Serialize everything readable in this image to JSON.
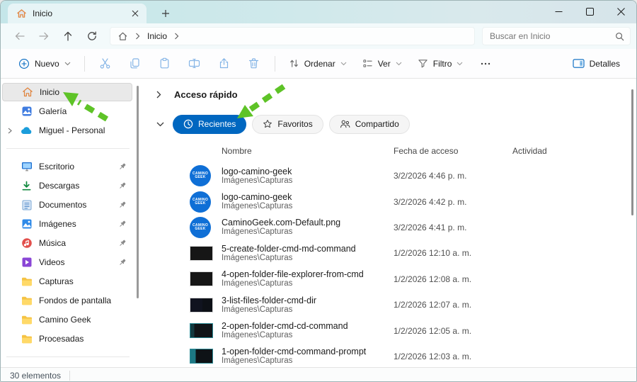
{
  "colors": {
    "accent_blue": "#0067c0",
    "arrow_green": "#5ec327",
    "logo_blue": "#0f6fd6",
    "folder_yellow": "#fdd56b"
  },
  "tab_bar": {
    "tab_label": "Inicio"
  },
  "nav": {
    "breadcrumb_root": "Inicio",
    "search_placeholder": "Buscar en Inicio"
  },
  "toolbar": {
    "new_label": "Nuevo",
    "sort_label": "Ordenar",
    "view_label": "Ver",
    "filter_label": "Filtro",
    "details_label": "Detalles"
  },
  "sidebar": {
    "items": [
      {
        "label": "Inicio",
        "icon": "home",
        "selected": true
      },
      {
        "label": "Galería",
        "icon": "gallery"
      },
      {
        "label": "Miguel - Personal",
        "icon": "onedrive",
        "expandable": true
      },
      {
        "label": "Escritorio",
        "icon": "desktop",
        "pinned": true
      },
      {
        "label": "Descargas",
        "icon": "downloads",
        "pinned": true
      },
      {
        "label": "Documentos",
        "icon": "documents",
        "pinned": true
      },
      {
        "label": "Imágenes",
        "icon": "pictures",
        "pinned": true
      },
      {
        "label": "Música",
        "icon": "music",
        "pinned": true
      },
      {
        "label": "Videos",
        "icon": "videos",
        "pinned": true
      },
      {
        "label": "Capturas",
        "icon": "folder"
      },
      {
        "label": "Fondos de pantalla",
        "icon": "folder"
      },
      {
        "label": "Camino Geek",
        "icon": "folder"
      },
      {
        "label": "Procesadas",
        "icon": "folder"
      }
    ]
  },
  "main": {
    "quick_access_title": "Acceso rápido",
    "tabs": [
      {
        "label": "Recientes",
        "active": true
      },
      {
        "label": "Favoritos",
        "active": false
      },
      {
        "label": "Compartido",
        "active": false
      }
    ],
    "columns": {
      "name": "Nombre",
      "date": "Fecha de acceso",
      "activity": "Actividad"
    },
    "logo_line1": "CAMINO",
    "logo_line2": "GEEK",
    "files": [
      {
        "name": "logo-camino-geek",
        "path": "Imágenes\\Capturas",
        "date": "3/2/2026 4:46 p. m.",
        "thumb": "logo"
      },
      {
        "name": "logo-camino-geek",
        "path": "Imágenes\\Capturas",
        "date": "3/2/2026 4:42 p. m.",
        "thumb": "logo"
      },
      {
        "name": "CaminoGeek.com-Default.png",
        "path": "Imágenes\\Capturas",
        "date": "3/2/2026 4:41 p. m.",
        "thumb": "logo"
      },
      {
        "name": "5-create-folder-cmd-md-command",
        "path": "Imágenes\\Capturas",
        "date": "1/2/2026 12:10 a. m.",
        "thumb": "cmd-dark"
      },
      {
        "name": "4-open-folder-file-explorer-from-cmd",
        "path": "Imágenes\\Capturas",
        "date": "1/2/2026 12:08 a. m.",
        "thumb": "cmd-dark"
      },
      {
        "name": "3-list-files-folder-cmd-dir",
        "path": "Imágenes\\Capturas",
        "date": "1/2/2026 12:07 a. m.",
        "thumb": "cmd-blue"
      },
      {
        "name": "2-open-folder-cmd-cd-command",
        "path": "Imágenes\\Capturas",
        "date": "1/2/2026 12:05 a. m.",
        "thumb": "cmd-teal-edge"
      },
      {
        "name": "1-open-folder-cmd-command-prompt",
        "path": "Imágenes\\Capturas",
        "date": "1/2/2026 12:03 a. m.",
        "thumb": "cmd-teal-band"
      }
    ]
  },
  "status_bar": {
    "items_count": "30 elementos"
  }
}
